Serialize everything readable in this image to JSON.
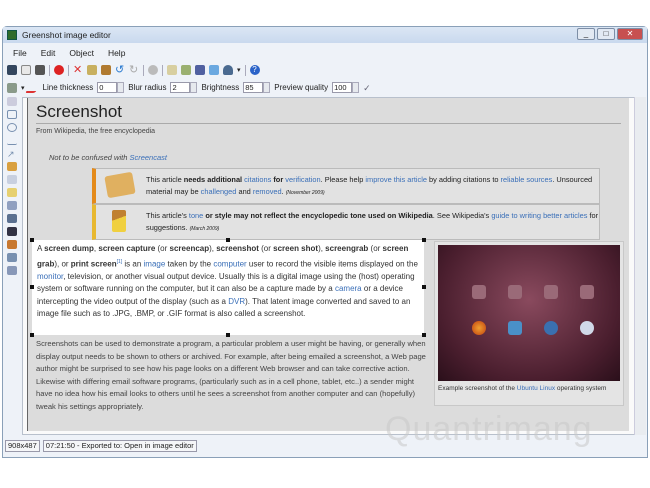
{
  "window": {
    "title": "Greenshot image editor",
    "buttons": [
      "_",
      "□",
      "✕"
    ]
  },
  "menu": [
    "File",
    "Edit",
    "Object",
    "Help"
  ],
  "toolbar1_icons": [
    "save-icon",
    "clipboard-icon",
    "print-icon",
    "close-red-icon",
    "delete-icon",
    "cut-icon",
    "paste-icon",
    "undo-icon",
    "redo-icon",
    "settings-icon",
    "email-icon",
    "export-icon",
    "upload-icon",
    "dropbox-icon",
    "plugin-icon",
    "help-icon"
  ],
  "toolbar2": {
    "line_thickness_label": "Line thickness",
    "line_thickness": "0",
    "blur_radius_label": "Blur radius",
    "blur_radius": "2",
    "brightness_label": "Brightness",
    "brightness": "85",
    "preview_quality_label": "Preview quality",
    "preview_quality": "100"
  },
  "article": {
    "title": "Screenshot",
    "subtitle": "From Wikipedia, the free encyclopedia",
    "note_prefix": "Not to be confused with ",
    "note_link": "Screencast",
    "amb1": {
      "t1": "This article ",
      "b1": "needs additional ",
      "l1": "citations",
      "b2": " for ",
      "l2": "verification",
      "t2": ". Please help ",
      "l3": "improve this article",
      "t3": " by adding citations to ",
      "l4": "reliable sources",
      "t4": ". Unsourced material may be ",
      "l5": "challenged",
      "t5": " and ",
      "l6": "removed",
      "t6": ". ",
      "date": "(November 2009)"
    },
    "amb2": {
      "t1": "This article's ",
      "l1": "tone",
      "b1": " or style may not reflect the encyclopedic tone used on Wikipedia",
      "t2": ". See Wikipedia's ",
      "l2": "guide to writing better articles",
      "t3": " for suggestions. ",
      "date": "(March 2009)"
    },
    "para1": {
      "a": "A ",
      "b1": "screen dump",
      "c1": ", ",
      "b2": "screen capture",
      "c2": " (or ",
      "b3": "screencap",
      "c3": "), ",
      "b4": "screenshot",
      "c4": " (or ",
      "b5": "screen shot",
      "c5": "), ",
      "b6": "screengrab",
      "c6": " (or ",
      "b7": "screen grab",
      "c7": "), or ",
      "b8": "print screen",
      "sup": "[1]",
      "c8": " is an ",
      "l1": "image",
      "c9": " taken by the ",
      "l2": "computer",
      "c10": " user to record the visible items displayed on the ",
      "l3": "monitor",
      "c11": ", television, or another visual output device. Usually this is a digital image using the (host) operating system or software running on the computer, but it can also be a capture made by a ",
      "l4": "camera",
      "c12": " or a device intercepting the video output of the display (such as a ",
      "l5": "DVR",
      "c13": "). That latent image converted and saved to an image file such as to .JPG, .BMP, or .GIF format is also called a screenshot."
    },
    "para2": "Screenshots can be used to demonstrate a program, a particular problem a user might be having, or generally when display output needs to be shown to others or archived. For example, after being emailed a screenshot, a Web page author might be surprised to see how his page looks on a different Web browser and can take corrective action. Likewise with differing email software programs, (particularly such as in a cell phone, tablet, etc..) a sender might have no idea how his email looks to others until he sees a screenshot from another computer and can (hopefully) tweak his settings appropriately.",
    "caption": {
      "a": "Example screenshot of the ",
      "link": "Ubuntu Linux",
      "b": " operating system"
    }
  },
  "status": {
    "size": "908x487",
    "message": "07:21:50 - Exported to: Open in image editor"
  },
  "watermark": "Quantrimang"
}
